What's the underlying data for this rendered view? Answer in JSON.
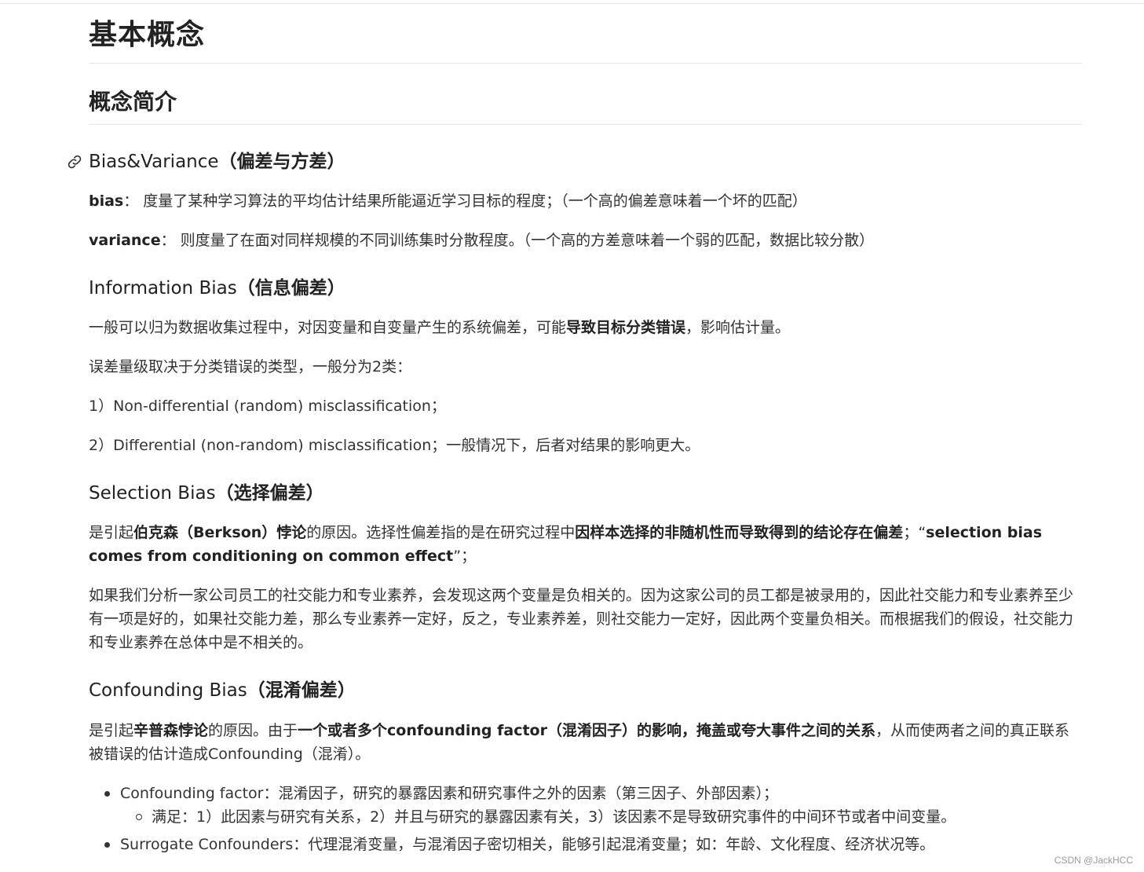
{
  "title": "基本概念",
  "section": "概念简介",
  "bias_variance": {
    "heading_en": "Bias&Variance",
    "heading_cn": "（偏差与方差）",
    "bias_label": "bias",
    "bias_text": "： 度量了某种学习算法的平均估计结果所能逼近学习目标的程度；（一个高的偏差意味着一个坏的匹配）",
    "variance_label": "variance",
    "variance_text": "： 则度量了在面对同样规模的不同训练集时分散程度。（一个高的方差意味着一个弱的匹配，数据比较分散）"
  },
  "information_bias": {
    "heading_en": "Information Bias",
    "heading_cn": "（信息偏差）",
    "p1_a": "一般可以归为数据收集过程中，对因变量和自变量产生的系统偏差，可能",
    "p1_bold": "导致目标分类错误",
    "p1_b": "，影响估计量。",
    "p2": "误差量级取决于分类错误的类型，一般分为2类：",
    "p3": "1）Non-differential (random) misclassification；",
    "p4": "2）Differential (non-random) misclassification；一般情况下，后者对结果的影响更大。"
  },
  "selection_bias": {
    "heading_en": "Selection Bias",
    "heading_cn": "（选择偏差）",
    "p1_a": "是引起",
    "p1_bold1": "伯克森（Berkson）悖论",
    "p1_b": "的原因。选择性偏差指的是在研究过程中",
    "p1_bold2": "因样本选择的非随机性而导致得到的结论存在偏差",
    "p1_c": "；“",
    "p1_bold3": "selection bias comes from conditioning on common effect",
    "p1_d": "”；",
    "p2": "如果我们分析一家公司员工的社交能力和专业素养，会发现这两个变量是负相关的。因为这家公司的员工都是被录用的，因此社交能力和专业素养至少有一项是好的，如果社交能力差，那么专业素养一定好，反之，专业素养差，则社交能力一定好，因此两个变量负相关。而根据我们的假设，社交能力和专业素养在总体中是不相关的。"
  },
  "confounding_bias": {
    "heading_en": "Confounding Bias",
    "heading_cn": "（混淆偏差）",
    "p1_a": "是引起",
    "p1_bold1": "辛普森悖论",
    "p1_b": "的原因。由于",
    "p1_bold2": "一个或者多个confounding factor（混淆因子）的影响，掩盖或夸大事件之间的关系",
    "p1_c": "，从而使两者之间的真正联系被错误的估计造成Confounding（混淆）。",
    "bullet1": "Confounding factor：混淆因子，研究的暴露因素和研究事件之外的因素（第三因子、外部因素）；",
    "bullet1_sub": "满足：1）此因素与研究有关系，2）并且与研究的暴露因素有关，3）该因素不是导致研究事件的中间环节或者中间变量。",
    "bullet2": "Surrogate Confounders：代理混淆变量，与混淆因子密切相关，能够引起混淆变量；如：年龄、文化程度、经济状况等。"
  },
  "watermark": "CSDN @JackHCC"
}
